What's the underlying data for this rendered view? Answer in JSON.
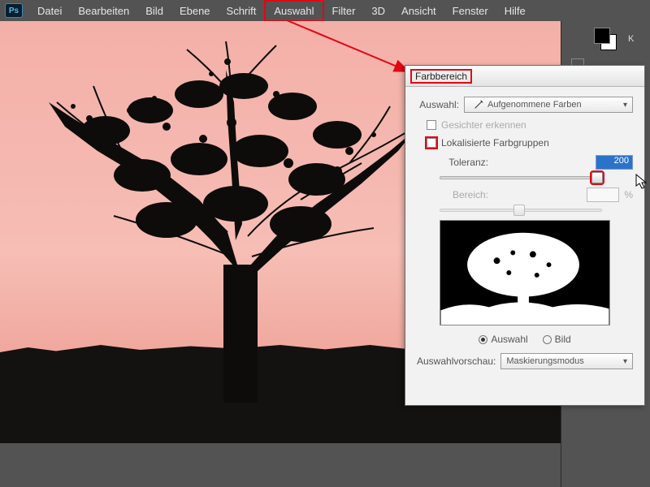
{
  "app": {
    "logo_text": "Ps"
  },
  "menu": {
    "items": [
      "Datei",
      "Bearbeiten",
      "Bild",
      "Ebene",
      "Schrift",
      "Auswahl",
      "Filter",
      "3D",
      "Ansicht",
      "Fenster",
      "Hilfe"
    ],
    "highlighted_index": 5
  },
  "right_panel": {
    "mode_letter": "K"
  },
  "dialog": {
    "title": "Farbbereich",
    "select_label": "Auswahl:",
    "select_value": "Aufgenommene Farben",
    "detect_faces_label": "Gesichter erkennen",
    "detect_faces_checked": false,
    "localized_label": "Lokalisierte Farbgruppen",
    "localized_checked": false,
    "tolerance_label": "Toleranz:",
    "tolerance_value": "200",
    "range_label": "Bereich:",
    "range_unit": "%",
    "radio_selection": "Auswahl",
    "radio_image": "Bild",
    "radio_checked": "selection",
    "preview_select_label": "Auswahlvorschau:",
    "preview_select_value": "Maskierungsmodus"
  }
}
